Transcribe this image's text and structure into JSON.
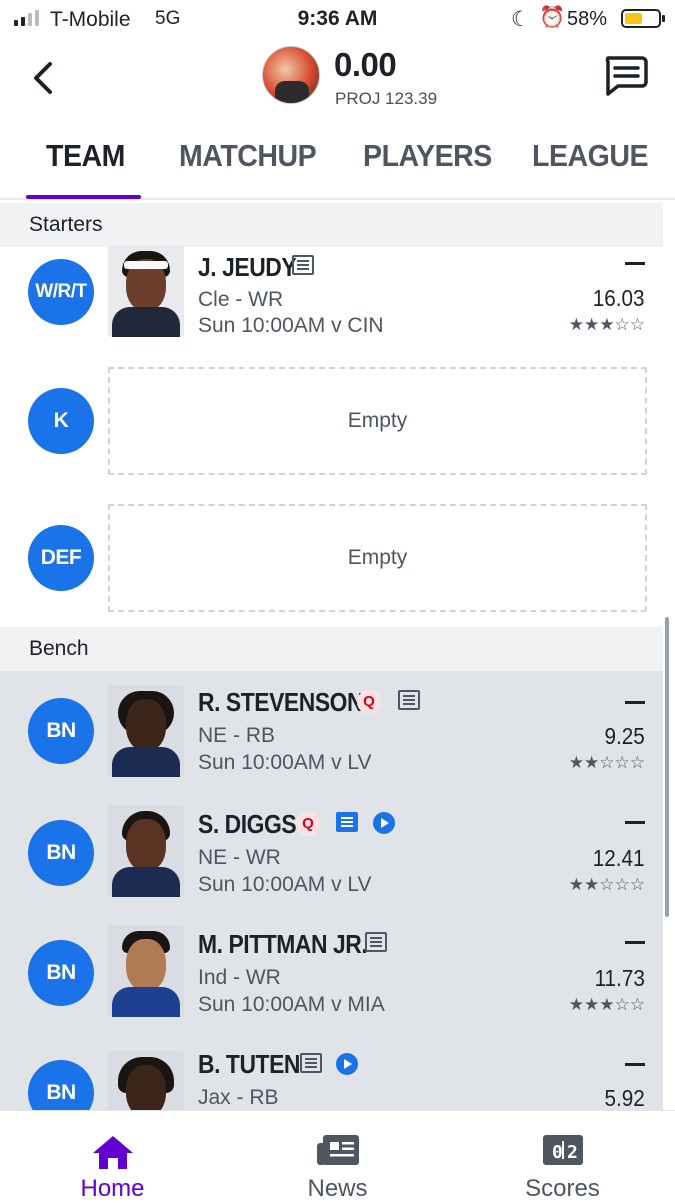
{
  "status_bar": {
    "carrier": "T-Mobile",
    "network": "5G",
    "time": "9:36 AM",
    "battery_percent": "58%"
  },
  "header": {
    "score": "0.00",
    "projection": "PROJ 123.39"
  },
  "tabs": [
    {
      "label": "TEAM",
      "active": true
    },
    {
      "label": "MATCHUP",
      "active": false
    },
    {
      "label": "PLAYERS",
      "active": false
    },
    {
      "label": "LEAGUE",
      "active": false
    }
  ],
  "starters": {
    "label": "Starters",
    "rows": [
      {
        "position": "W/R/T",
        "name": "J. JEUDY",
        "team_pos": "Cle - WR",
        "game": "Sun 10:00AM v CIN",
        "points": "16.03",
        "stars": "★★★☆☆"
      },
      {
        "position": "K",
        "empty_label": "Empty"
      },
      {
        "position": "DEF",
        "empty_label": "Empty"
      }
    ]
  },
  "bench": {
    "label": "Bench",
    "rows": [
      {
        "position": "BN",
        "name": "R. STEVENSON",
        "status": "Q",
        "team_pos": "NE - RB",
        "game": "Sun 10:00AM v LV",
        "points": "9.25",
        "stars": "★★☆☆☆"
      },
      {
        "position": "BN",
        "name": "S. DIGGS",
        "status": "Q",
        "team_pos": "NE - WR",
        "game": "Sun 10:00AM v LV",
        "points": "12.41",
        "stars": "★★☆☆☆"
      },
      {
        "position": "BN",
        "name": "M. PITTMAN JR.",
        "team_pos": "Ind - WR",
        "game": "Sun 10:00AM v MIA",
        "points": "11.73",
        "stars": "★★★☆☆"
      },
      {
        "position": "BN",
        "name": "B. TUTEN",
        "team_pos": "Jax - RB",
        "points": "5.92"
      }
    ]
  },
  "bottom_nav": [
    {
      "label": "Home",
      "icon": "home-icon",
      "active": true
    },
    {
      "label": "News",
      "icon": "news-icon",
      "active": false
    },
    {
      "label": "Scores",
      "icon": "scores-icon",
      "active": false
    }
  ],
  "colors": {
    "accent": "#6001d2",
    "position_badge": "#1a73e8",
    "bench_bg": "#e0e3e8",
    "questionable": "#d6001c"
  }
}
